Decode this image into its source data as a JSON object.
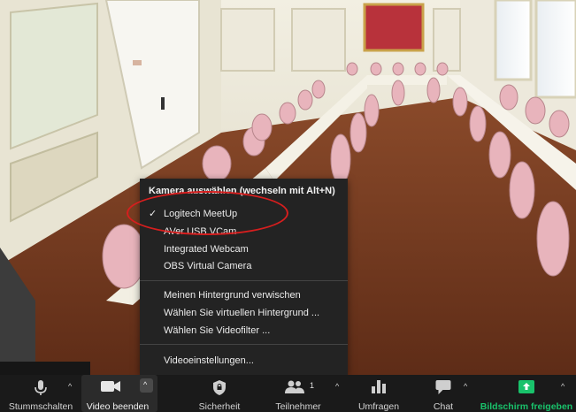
{
  "menu": {
    "header": "Kamera auswählen (wechseln mit Alt+N)",
    "cameras": [
      {
        "label": "Logitech MeetUp",
        "selected": true
      },
      {
        "label": "AVer USB VCam",
        "selected": false
      },
      {
        "label": "Integrated Webcam",
        "selected": false
      },
      {
        "label": "OBS Virtual Camera",
        "selected": false
      }
    ],
    "background_options": [
      {
        "label": "Meinen Hintergrund verwischen"
      },
      {
        "label": "Wählen Sie virtuellen Hintergrund ..."
      },
      {
        "label": "Wählen Sie Videofilter ..."
      }
    ],
    "settings_label": "Videoeinstellungen..."
  },
  "toolbar": {
    "mute_label": "Stummschalten",
    "video_label": "Video beenden",
    "security_label": "Sicherheit",
    "participants_label": "Teilnehmer",
    "participants_count": "1",
    "polls_label": "Umfragen",
    "chat_label": "Chat",
    "share_label": "Bildschirm freigeben"
  },
  "colors": {
    "toolbar_bg": "#1a1a1a",
    "menu_bg": "#232323",
    "share_green": "#19c26b",
    "highlight_red": "#d61e1e"
  },
  "icons": {
    "mute": "microphone-icon",
    "video": "video-camera-icon",
    "security": "shield-icon",
    "participants": "people-icon",
    "polls": "bar-chart-icon",
    "chat": "chat-bubble-icon",
    "share": "share-screen-icon",
    "check": "checkmark-icon"
  }
}
